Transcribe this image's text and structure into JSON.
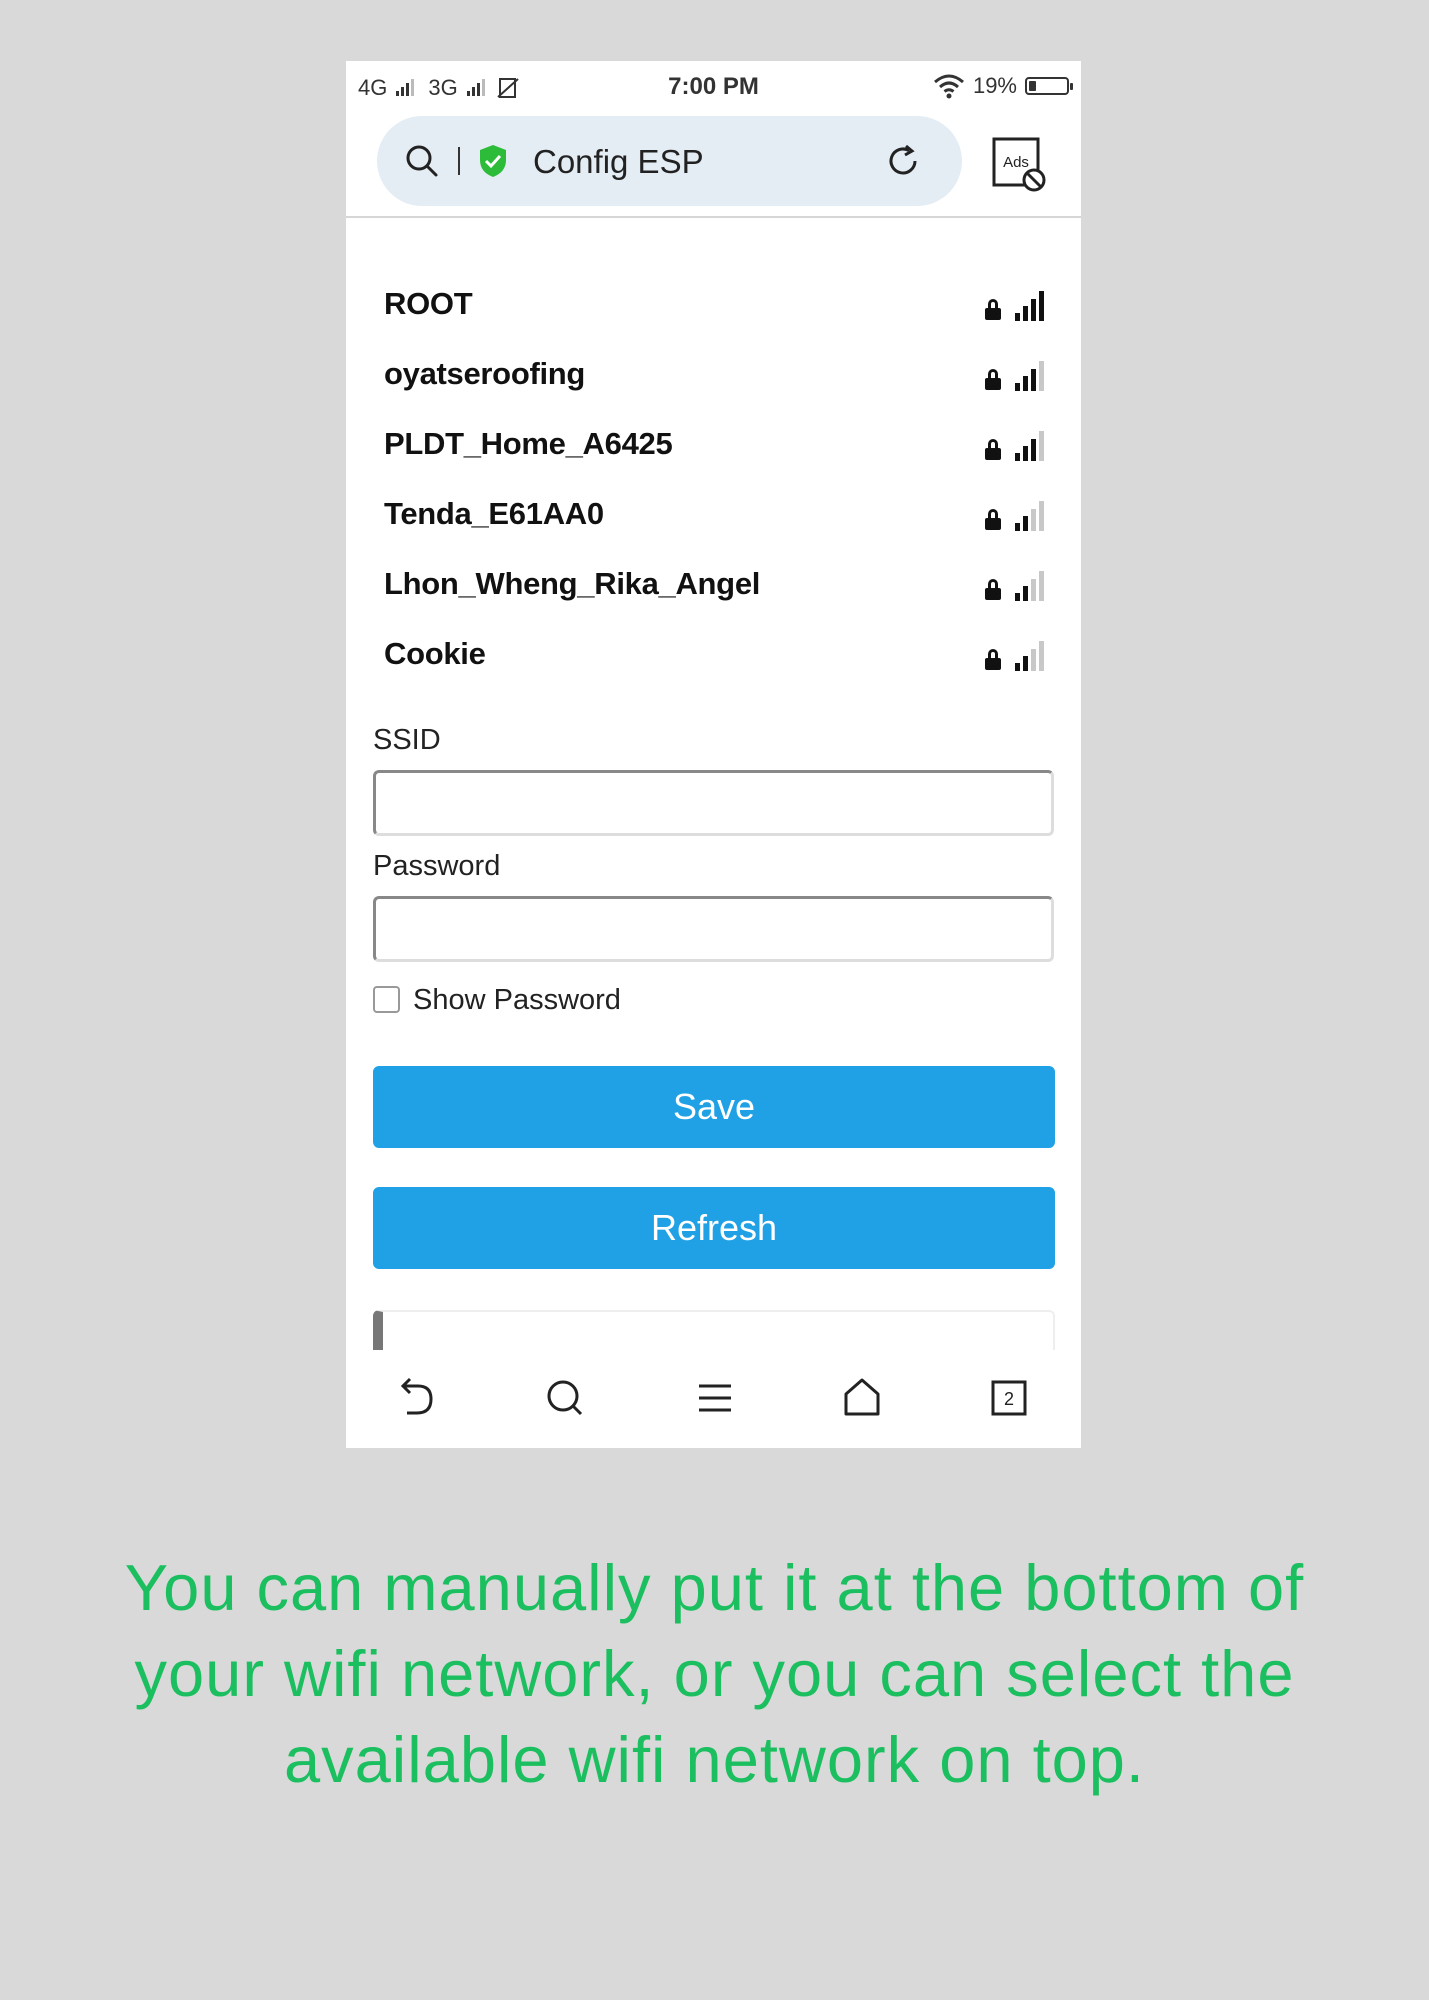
{
  "status_bar": {
    "network1": "4G",
    "network2": "3G",
    "time": "7:00 PM",
    "battery": "19%",
    "battery_level": 0.19
  },
  "address_bar": {
    "title": "Config ESP",
    "icons": [
      "search-icon",
      "shield-check-icon",
      "reload-icon",
      "ad-block-icon"
    ],
    "ads_label": "Ads"
  },
  "networks": [
    {
      "ssid": "ROOT",
      "strength": 4
    },
    {
      "ssid": "oyatseroofing",
      "strength": 3
    },
    {
      "ssid": "PLDT_Home_A6425",
      "strength": 3
    },
    {
      "ssid": "Tenda_E61AA0",
      "strength": 2
    },
    {
      "ssid": "Lhon_Wheng_Rika_Angel",
      "strength": 2
    },
    {
      "ssid": "Cookie",
      "strength": 2
    }
  ],
  "form": {
    "ssid_label": "SSID",
    "ssid_value": "",
    "password_label": "Password",
    "password_value": "",
    "show_password_label": "Show Password",
    "show_password_checked": false,
    "save_label": "Save",
    "refresh_label": "Refresh"
  },
  "bottom_nav": {
    "tabs_count": "2",
    "icons": [
      "back-icon",
      "search-icon",
      "menu-icon",
      "home-icon",
      "tabs-icon"
    ]
  },
  "caption": "You can manually put it at the bottom of your wifi network, or you can select the available wifi network on top.",
  "colors": {
    "background": "#d9d9d9",
    "button": "#20a1e6",
    "caption": "#1cbf5f",
    "shield": "#2dbb3a"
  }
}
